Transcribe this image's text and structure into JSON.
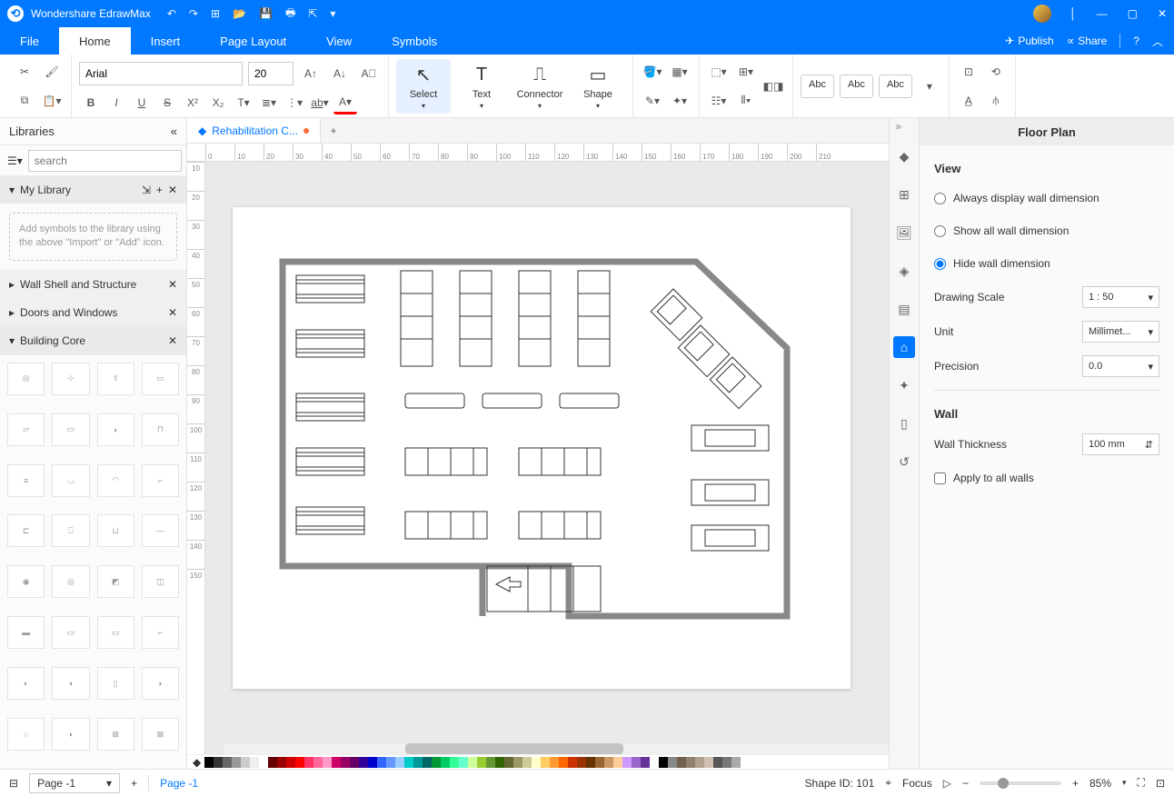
{
  "app": {
    "title": "Wondershare EdrawMax"
  },
  "menu": {
    "tabs": [
      "File",
      "Home",
      "Insert",
      "Page Layout",
      "View",
      "Symbols"
    ],
    "active": 1,
    "publish": "Publish",
    "share": "Share"
  },
  "ribbon": {
    "font": "Arial",
    "fontsize": "20",
    "tools": {
      "select": "Select",
      "text": "Text",
      "connector": "Connector",
      "shape": "Shape"
    },
    "abc": "Abc"
  },
  "libraries": {
    "title": "Libraries",
    "searchPlaceholder": "search",
    "mylib": "My Library",
    "mylibMsg": "Add symbols to the library using the above \"Import\" or \"Add\" icon.",
    "sections": [
      "Wall Shell and Structure",
      "Doors and Windows",
      "Building Core"
    ]
  },
  "doc": {
    "tabName": "Rehabilitation C..."
  },
  "ruler": {
    "ticks": [
      "0",
      "10",
      "20",
      "30",
      "40",
      "50",
      "60",
      "70",
      "80",
      "90",
      "100",
      "110",
      "120",
      "130",
      "140",
      "150",
      "160",
      "170",
      "180",
      "190",
      "200",
      "210"
    ]
  },
  "rulerV": {
    "ticks": [
      "10",
      "20",
      "30",
      "40",
      "50",
      "60",
      "70",
      "80",
      "90",
      "100",
      "110",
      "120",
      "130",
      "140",
      "150"
    ]
  },
  "prop": {
    "title": "Floor Plan",
    "viewHdr": "View",
    "opt1": "Always display wall dimension",
    "opt2": "Show all wall dimension",
    "opt3": "Hide wall dimension",
    "drawingScaleLbl": "Drawing Scale",
    "drawingScale": "1 : 50",
    "unitLbl": "Unit",
    "unit": "Millimet...",
    "precisionLbl": "Precision",
    "precision": "0.0",
    "wallHdr": "Wall",
    "wallThickLbl": "Wall Thickness",
    "wallThick": "100 mm",
    "applyAll": "Apply to all walls"
  },
  "status": {
    "pageSel": "Page -1",
    "pageName": "Page -1",
    "shapeId": "Shape ID: 101",
    "focus": "Focus",
    "zoom": "85%"
  },
  "colors": [
    "#000",
    "#333",
    "#666",
    "#999",
    "#ccc",
    "#eee",
    "#fff",
    "#600",
    "#900",
    "#c00",
    "#f00",
    "#f36",
    "#f69",
    "#f9c",
    "#c06",
    "#906",
    "#606",
    "#309",
    "#00c",
    "#36f",
    "#69f",
    "#9cf",
    "#0cc",
    "#099",
    "#066",
    "#093",
    "#0c6",
    "#3f9",
    "#6fc",
    "#cf9",
    "#9c3",
    "#693",
    "#360",
    "#663",
    "#996",
    "#cc9",
    "#ffc",
    "#fc6",
    "#f93",
    "#f60",
    "#c30",
    "#930",
    "#630",
    "#963",
    "#c96",
    "#fc9",
    "#c9f",
    "#96c",
    "#639",
    "#fff",
    "#000",
    "#888",
    "#706050",
    "#908070",
    "#b0a090",
    "#d0c0b0",
    "#555",
    "#777",
    "#aaa"
  ]
}
